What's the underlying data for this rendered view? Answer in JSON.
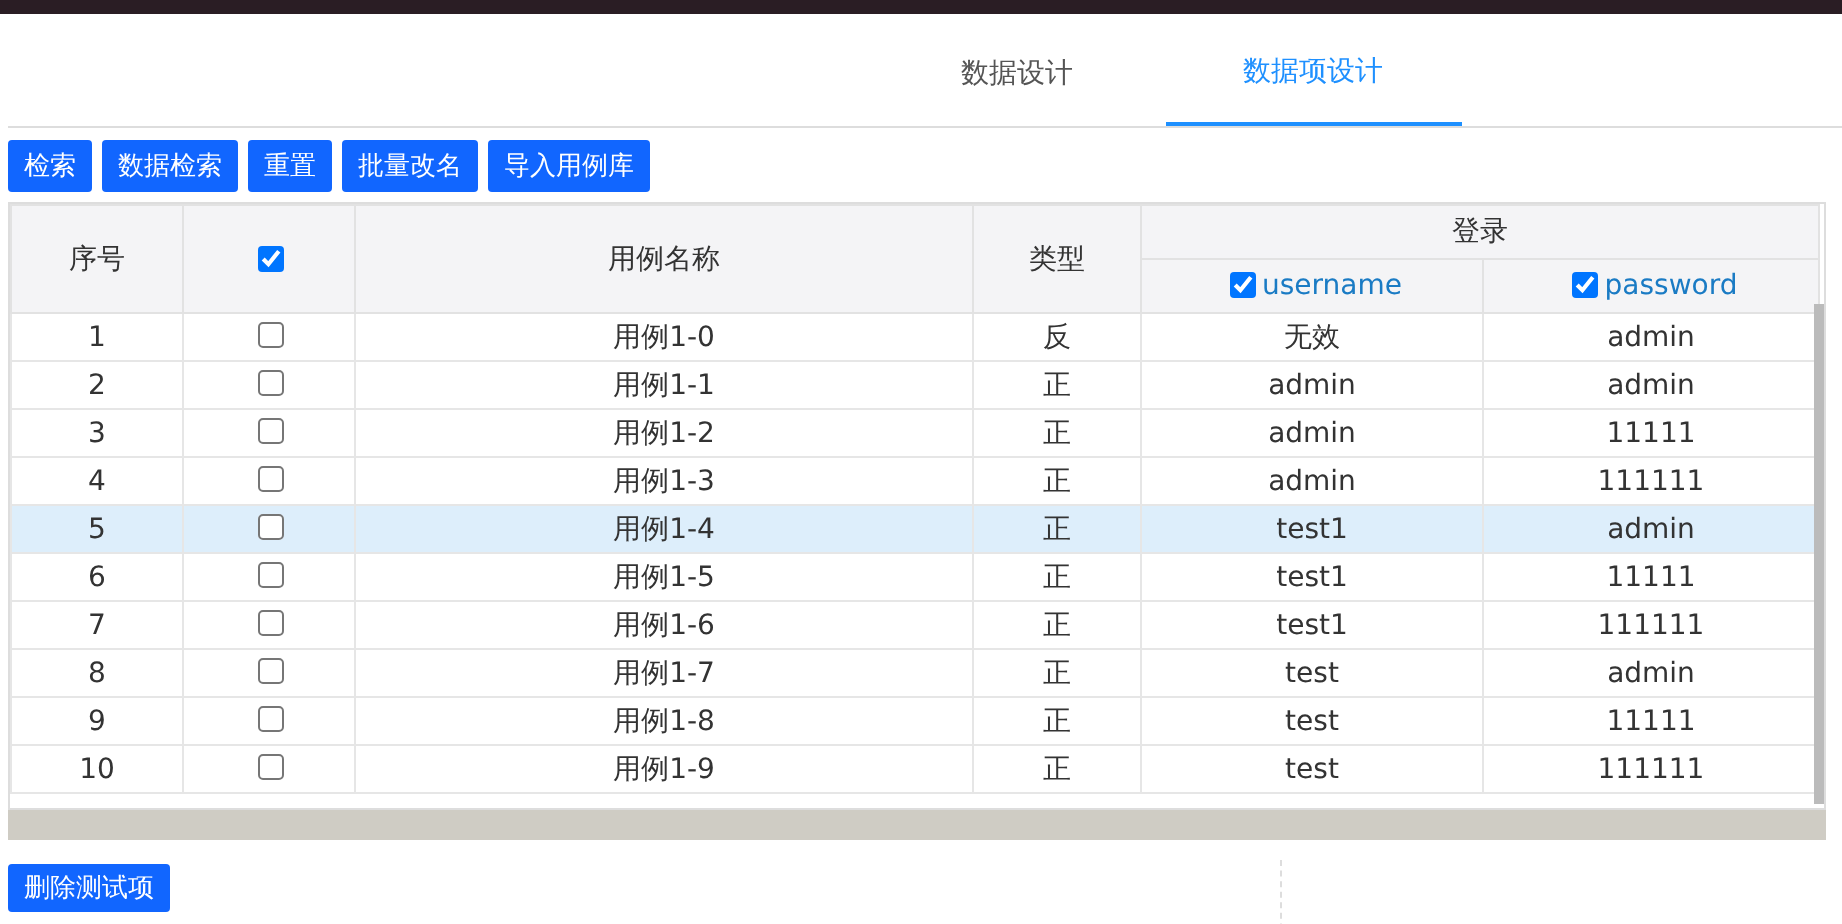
{
  "tabs": [
    {
      "label": "数据设计",
      "selected": false
    },
    {
      "label": "数据项设计",
      "selected": true
    }
  ],
  "toolbar": [
    "检索",
    "数据检索",
    "重置",
    "批量改名",
    "导入用例库"
  ],
  "table": {
    "columns": {
      "index": "序号",
      "select_all": {
        "checked": true
      },
      "name": "用例名称",
      "type": "类型",
      "group": "登录",
      "fields": [
        {
          "label": "username",
          "checked": true
        },
        {
          "label": "password",
          "checked": true
        }
      ]
    },
    "rows": [
      {
        "index": "1",
        "checked": false,
        "selected": false,
        "name": "用例1-0",
        "type": "反",
        "values": [
          "无效",
          "admin"
        ]
      },
      {
        "index": "2",
        "checked": false,
        "selected": false,
        "name": "用例1-1",
        "type": "正",
        "values": [
          "admin",
          "admin"
        ]
      },
      {
        "index": "3",
        "checked": false,
        "selected": false,
        "name": "用例1-2",
        "type": "正",
        "values": [
          "admin",
          "11111"
        ]
      },
      {
        "index": "4",
        "checked": false,
        "selected": false,
        "name": "用例1-3",
        "type": "正",
        "values": [
          "admin",
          "111111"
        ]
      },
      {
        "index": "5",
        "checked": false,
        "selected": true,
        "name": "用例1-4",
        "type": "正",
        "values": [
          "test1",
          "admin"
        ]
      },
      {
        "index": "6",
        "checked": false,
        "selected": false,
        "name": "用例1-5",
        "type": "正",
        "values": [
          "test1",
          "11111"
        ]
      },
      {
        "index": "7",
        "checked": false,
        "selected": false,
        "name": "用例1-6",
        "type": "正",
        "values": [
          "test1",
          "111111"
        ]
      },
      {
        "index": "8",
        "checked": false,
        "selected": false,
        "name": "用例1-7",
        "type": "正",
        "values": [
          "test",
          "admin"
        ]
      },
      {
        "index": "9",
        "checked": false,
        "selected": false,
        "name": "用例1-8",
        "type": "正",
        "values": [
          "test",
          "11111"
        ]
      },
      {
        "index": "10",
        "checked": false,
        "selected": false,
        "name": "用例1-9",
        "type": "正",
        "values": [
          "test",
          "111111"
        ]
      }
    ]
  },
  "delete_button": "删除测试项"
}
